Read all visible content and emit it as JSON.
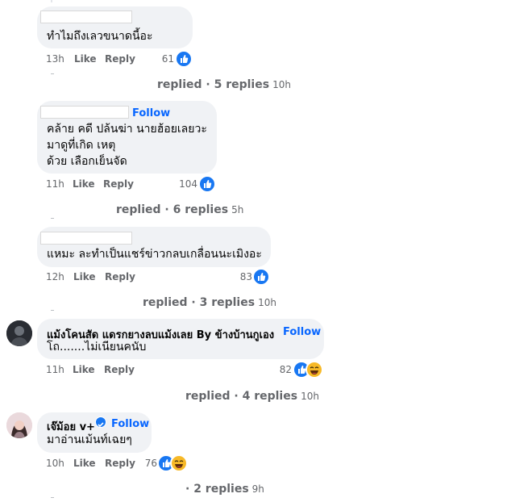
{
  "comments": [
    {
      "author": "",
      "follow": "",
      "text": [
        "ทำไมถึงเลวขนาดนี้อะ"
      ],
      "time": "13h",
      "like": "Like",
      "reply": "Reply",
      "count": "61",
      "replies_label": "replied · 5 replies",
      "replies_ago": "10h"
    },
    {
      "author": "",
      "follow": "Follow",
      "text": [
        "คล้าย คดี ปล้นฆ่า นายฮ้อยเลยวะ",
        "มาดูที่เกิด เหตุ",
        "ด้วย เลือกเย็นจัด"
      ],
      "time": "11h",
      "like": "Like",
      "reply": "Reply",
      "count": "104",
      "replies_label": "replied · 6 replies",
      "replies_ago": "5h"
    },
    {
      "author": "",
      "follow": "",
      "text": [
        "แหมะ ละทำเป็นแชร์ข่าวกลบเกลื่อนนะเมิงอะ"
      ],
      "time": "12h",
      "like": "Like",
      "reply": "Reply",
      "count": "83",
      "replies_label": "replied · 3 replies",
      "replies_ago": "10h"
    },
    {
      "author": "แม้งโคนสัด แดรกยางลบแม้งเลย By ข้างบ้านกูเอง",
      "follow": "Follow",
      "text": [
        "โถ.......ไม่เนียนคนับ"
      ],
      "time": "11h",
      "like": "Like",
      "reply": "Reply",
      "count": "82",
      "replies_label": "replied · 4 replies",
      "replies_ago": "10h"
    },
    {
      "author": "เจ๊ม้อย v+",
      "follow": "Follow",
      "text": [
        "มาอ่านเม้นท์เฉยๆ"
      ],
      "time": "10h",
      "like": "Like",
      "reply": "Reply",
      "count": "76",
      "replies_label": "· 2 replies",
      "replies_ago": "9h"
    }
  ],
  "colors": {
    "link": "#0866ff",
    "like": "#1877f2",
    "haha": "#f7b928",
    "bubble": "#f0f2f5",
    "meta": "#65676b"
  },
  "icons": {
    "like": "like-reaction-icon",
    "haha": "haha-reaction-icon",
    "verified": "verified-badge-icon"
  }
}
